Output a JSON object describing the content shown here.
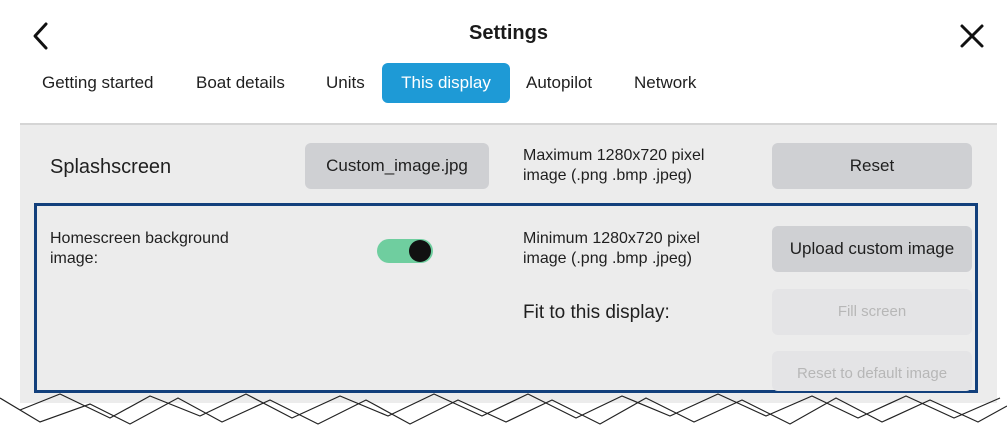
{
  "header": {
    "title": "Settings",
    "back_icon": "chevron-left-icon",
    "close_icon": "close-icon"
  },
  "tabs": [
    {
      "label": "Getting started",
      "active": false
    },
    {
      "label": "Boat details",
      "active": false
    },
    {
      "label": "Units",
      "active": false
    },
    {
      "label": "This display",
      "active": true
    },
    {
      "label": "Autopilot",
      "active": false
    },
    {
      "label": "Network",
      "active": false
    }
  ],
  "splashscreen": {
    "label": "Splashscreen",
    "file_button": "Custom_image.jpg",
    "hint_line1": "Maximum 1280x720 pixel",
    "hint_line2": "image (.png .bmp .jpeg)",
    "reset_button": "Reset"
  },
  "homescreen": {
    "label_line1": "Homescreen background",
    "label_line2": "image:",
    "toggle_on": true,
    "hint_line1": "Minimum 1280x720 pixel",
    "hint_line2": "image (.png .bmp .jpeg)",
    "upload_button": "Upload custom image",
    "fit_label": "Fit to this display:",
    "fill_button": "Fill screen",
    "reset_default_button": "Reset to default image"
  },
  "colors": {
    "accent": "#1e9ad6",
    "highlight_border": "#12407c",
    "toggle_on": "#6fce9f"
  }
}
